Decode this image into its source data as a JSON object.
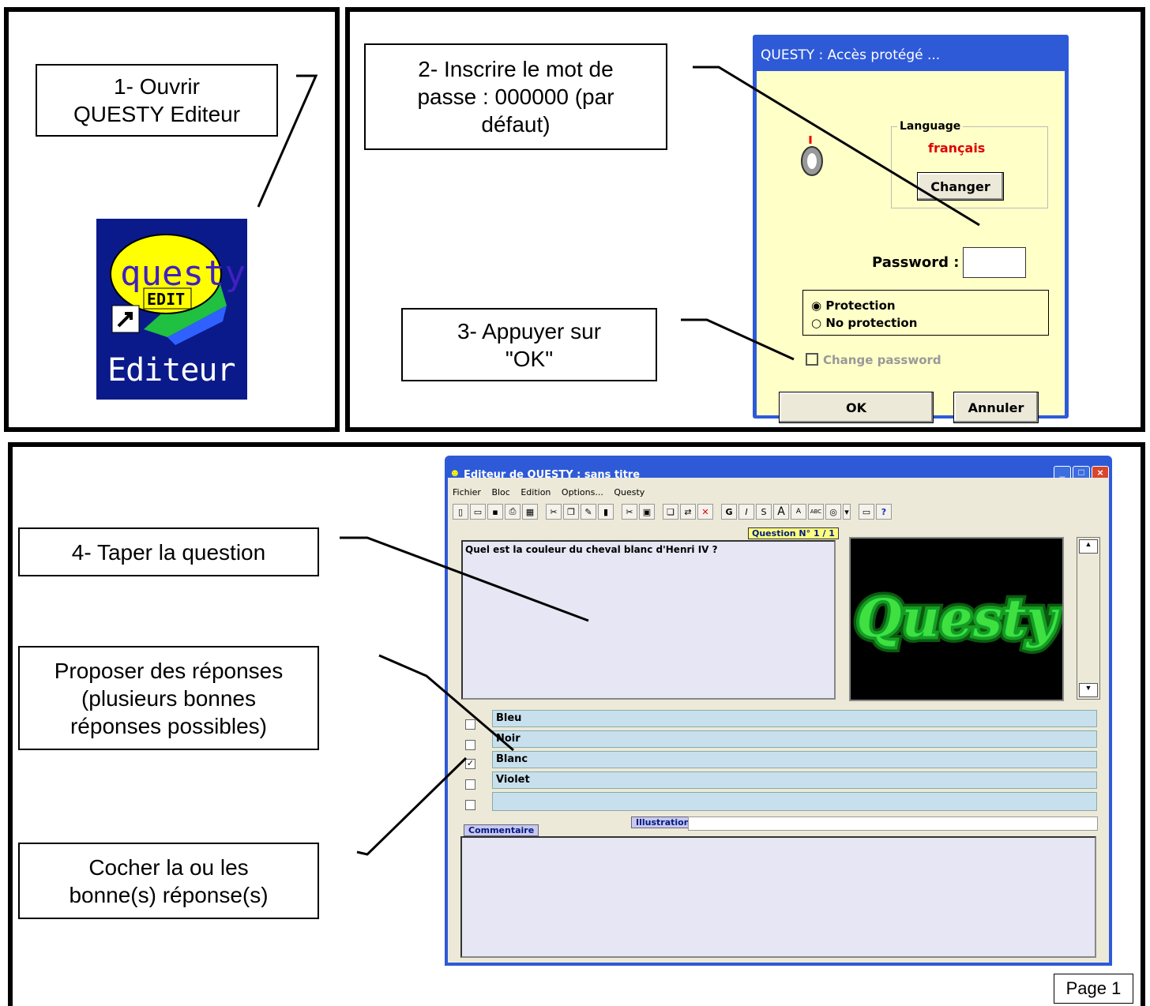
{
  "steps": {
    "step1": "1- Ouvrir\nQUESTY Editeur",
    "step2": "2- Inscrire le mot de\npasse : 000000 (par\ndéfaut)",
    "step3": "3- Appuyer sur\n\"OK\"",
    "step4": "4- Taper la question",
    "step5": "Proposer des réponses\n(plusieurs bonnes\nréponses possibles)",
    "step6": "Cocher la ou les\nbonne(s) réponse(s)"
  },
  "desktop_icon": {
    "logo_text": "questy",
    "sub_text": "EDIT",
    "caption": "Editeur"
  },
  "login_dialog": {
    "title": "QUESTY : Accès protégé ...",
    "language_group": "Language",
    "language_value": "français",
    "change_button": "Changer",
    "password_label": "Password :",
    "password_value": "",
    "radio_protection": "Protection",
    "radio_no_protection": "No protection",
    "change_password": "Change password",
    "ok_button": "OK",
    "cancel_button": "Annuler",
    "colors": {
      "title_bar": "#2e5ad8",
      "body": "#ffffc8",
      "language_value": "#e00000"
    }
  },
  "editor": {
    "title": "Editeur de QUESTY : sans titre",
    "menu": [
      "Fichier",
      "Bloc",
      "Edition",
      "Options...",
      "Questy"
    ],
    "question_counter": "Question N° 1 / 1",
    "question_text": "Quel est la couleur du cheval blanc d'Henri IV ?",
    "image_text": "Questy",
    "answers": [
      {
        "text": "Bleu",
        "checked": false
      },
      {
        "text": "Noir",
        "checked": false
      },
      {
        "text": "Blanc",
        "checked": true
      },
      {
        "text": "Violet",
        "checked": false
      },
      {
        "text": "",
        "checked": false
      }
    ],
    "tab_comment": "Commentaire",
    "tab_illustration": "Illustration",
    "toolbar_text_buttons": [
      "G",
      "I",
      "S",
      "A",
      "A",
      "ABC"
    ]
  },
  "page_label": "Page 1"
}
